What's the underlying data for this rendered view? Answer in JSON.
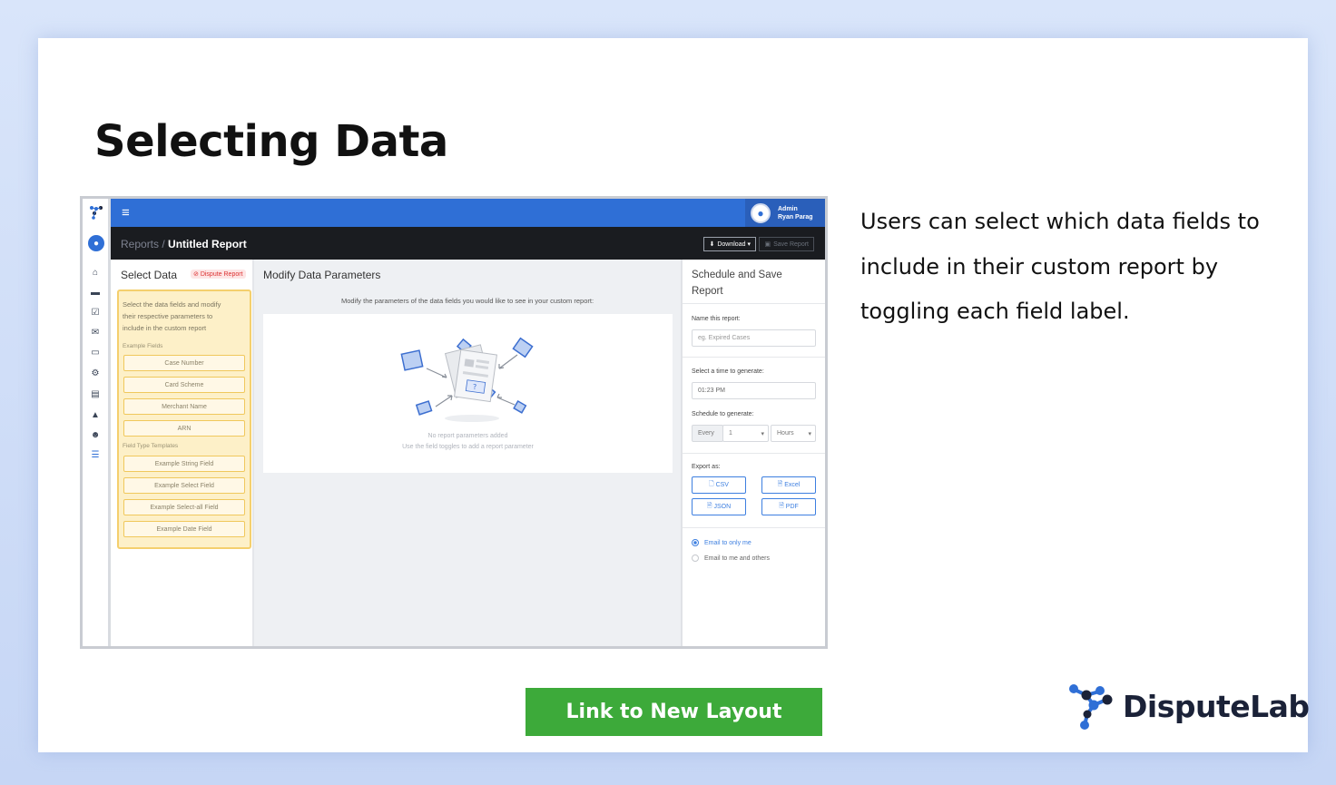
{
  "slide": {
    "title": "Selecting Data",
    "description_lines": [
      "Users can select which data fields to",
      "include in their custom report by",
      "toggling each field label."
    ],
    "cta_label": "Link to New Layout",
    "logo_text": "DisputeLab"
  },
  "app": {
    "topbar": {
      "user_role": "Admin",
      "user_name": "Ryan Parag"
    },
    "breadcrumb": {
      "parent": "Reports",
      "separator": " / ",
      "current": "Untitled Report"
    },
    "toolbar": {
      "download_label": "Download",
      "save_label": "Save Report"
    },
    "select_data": {
      "heading": "Select Data",
      "tag": "Dispute Report",
      "instructions": "Select the data fields and modify their respective parameters to include in the custom report",
      "example_fields_label": "Example Fields",
      "example_fields": [
        "Case Number",
        "Card Scheme",
        "Merchant Name",
        "ARN"
      ],
      "templates_label": "Field Type Templates",
      "templates": [
        "Example String Field",
        "Example Select Field",
        "Example Select-all Field",
        "Example Date Field"
      ]
    },
    "modify": {
      "heading": "Modify Data Parameters",
      "subheading": "Modify the parameters of the data fields you would like to see in your custom report:",
      "empty_title": "No report parameters added",
      "empty_hint": "Use the field toggles to add a report parameter"
    },
    "schedule": {
      "heading": "Schedule and Save Report",
      "name_label": "Name this report:",
      "name_placeholder": "eg. Expired Cases",
      "time_label": "Select a time to generate:",
      "time_value": "01:23 PM",
      "schedule_label": "Schedule to generate:",
      "every": "Every",
      "count": "1",
      "unit": "Hours",
      "export_label": "Export as:",
      "export_options": [
        "CSV",
        "Excel",
        "JSON",
        "PDF"
      ],
      "email_options": [
        "Email to only me",
        "Email to me and others"
      ],
      "email_selected": 0
    },
    "colors": {
      "primary": "#2f6fd6",
      "topbar_dark": "#1a1c20",
      "highlight_yellow": "#fdf0c8",
      "cta_green": "#3daa3a"
    }
  }
}
